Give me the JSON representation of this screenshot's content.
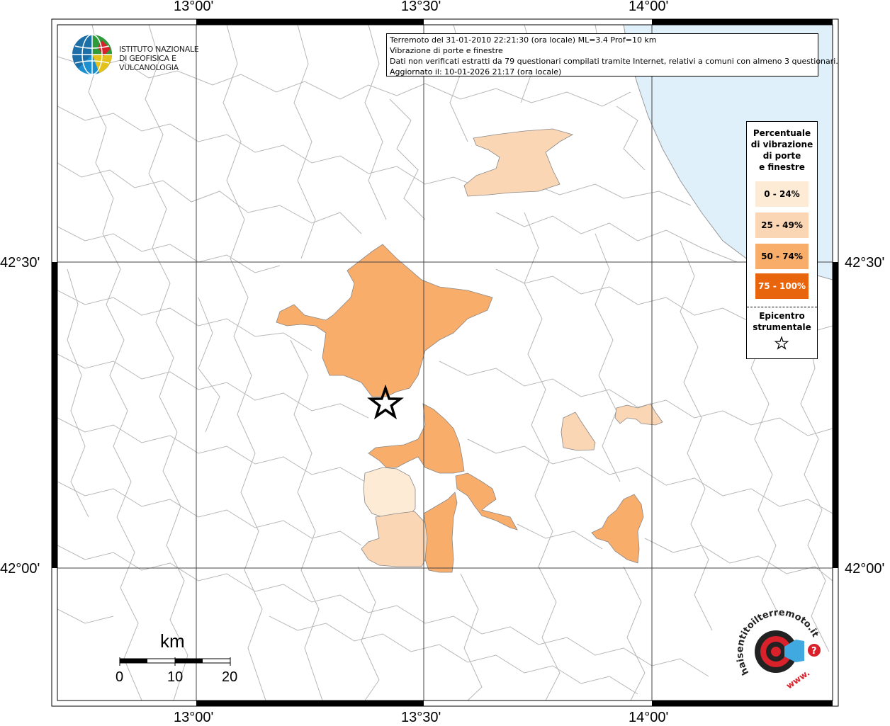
{
  "info": {
    "line1": "Terremoto del 31-01-2010 22:21:30 (ora locale) ML=3.4 Prof=10 km",
    "line2": "Vibrazione di porte e finestre",
    "line3": "Dati non verificati estratti da 79 questionari compilati tramite Internet, relativi a comuni con almeno 3 questionari.",
    "line4": "Aggiornato il: 10-01-2026 21:17 (ora locale)"
  },
  "logo": {
    "line1": "ISTITUTO NAZIONALE",
    "line2": "DI GEOFISICA E VULCANOLOGIA"
  },
  "coords": {
    "lon": [
      "13°00'",
      "13°30'",
      "14°00'"
    ],
    "lat": [
      "42°30'",
      "42°00'"
    ]
  },
  "legend": {
    "title": [
      "Percentuale",
      "di vibrazione",
      "di porte",
      "e finestre"
    ],
    "classes": [
      {
        "label": "0 - 24%",
        "color": "#fdebd6"
      },
      {
        "label": "25 - 49%",
        "color": "#fbd6b4"
      },
      {
        "label": "50 - 74%",
        "color": "#f8ad6b"
      },
      {
        "label": "75 - 100%",
        "color": "#e8650e"
      }
    ],
    "epicenter_title": [
      "Epicentro",
      "strumentale"
    ],
    "epicenter_icon": "star-icon"
  },
  "scale": {
    "unit": "km",
    "ticks": [
      "0",
      "10",
      "20"
    ]
  },
  "hsn_logo": {
    "text": "haisentitoilterremoto.it",
    "www": "www.",
    "q": "?"
  },
  "colors": {
    "sea": "#dff0fb",
    "border": "#b4b4b4",
    "grid": "#555555"
  }
}
